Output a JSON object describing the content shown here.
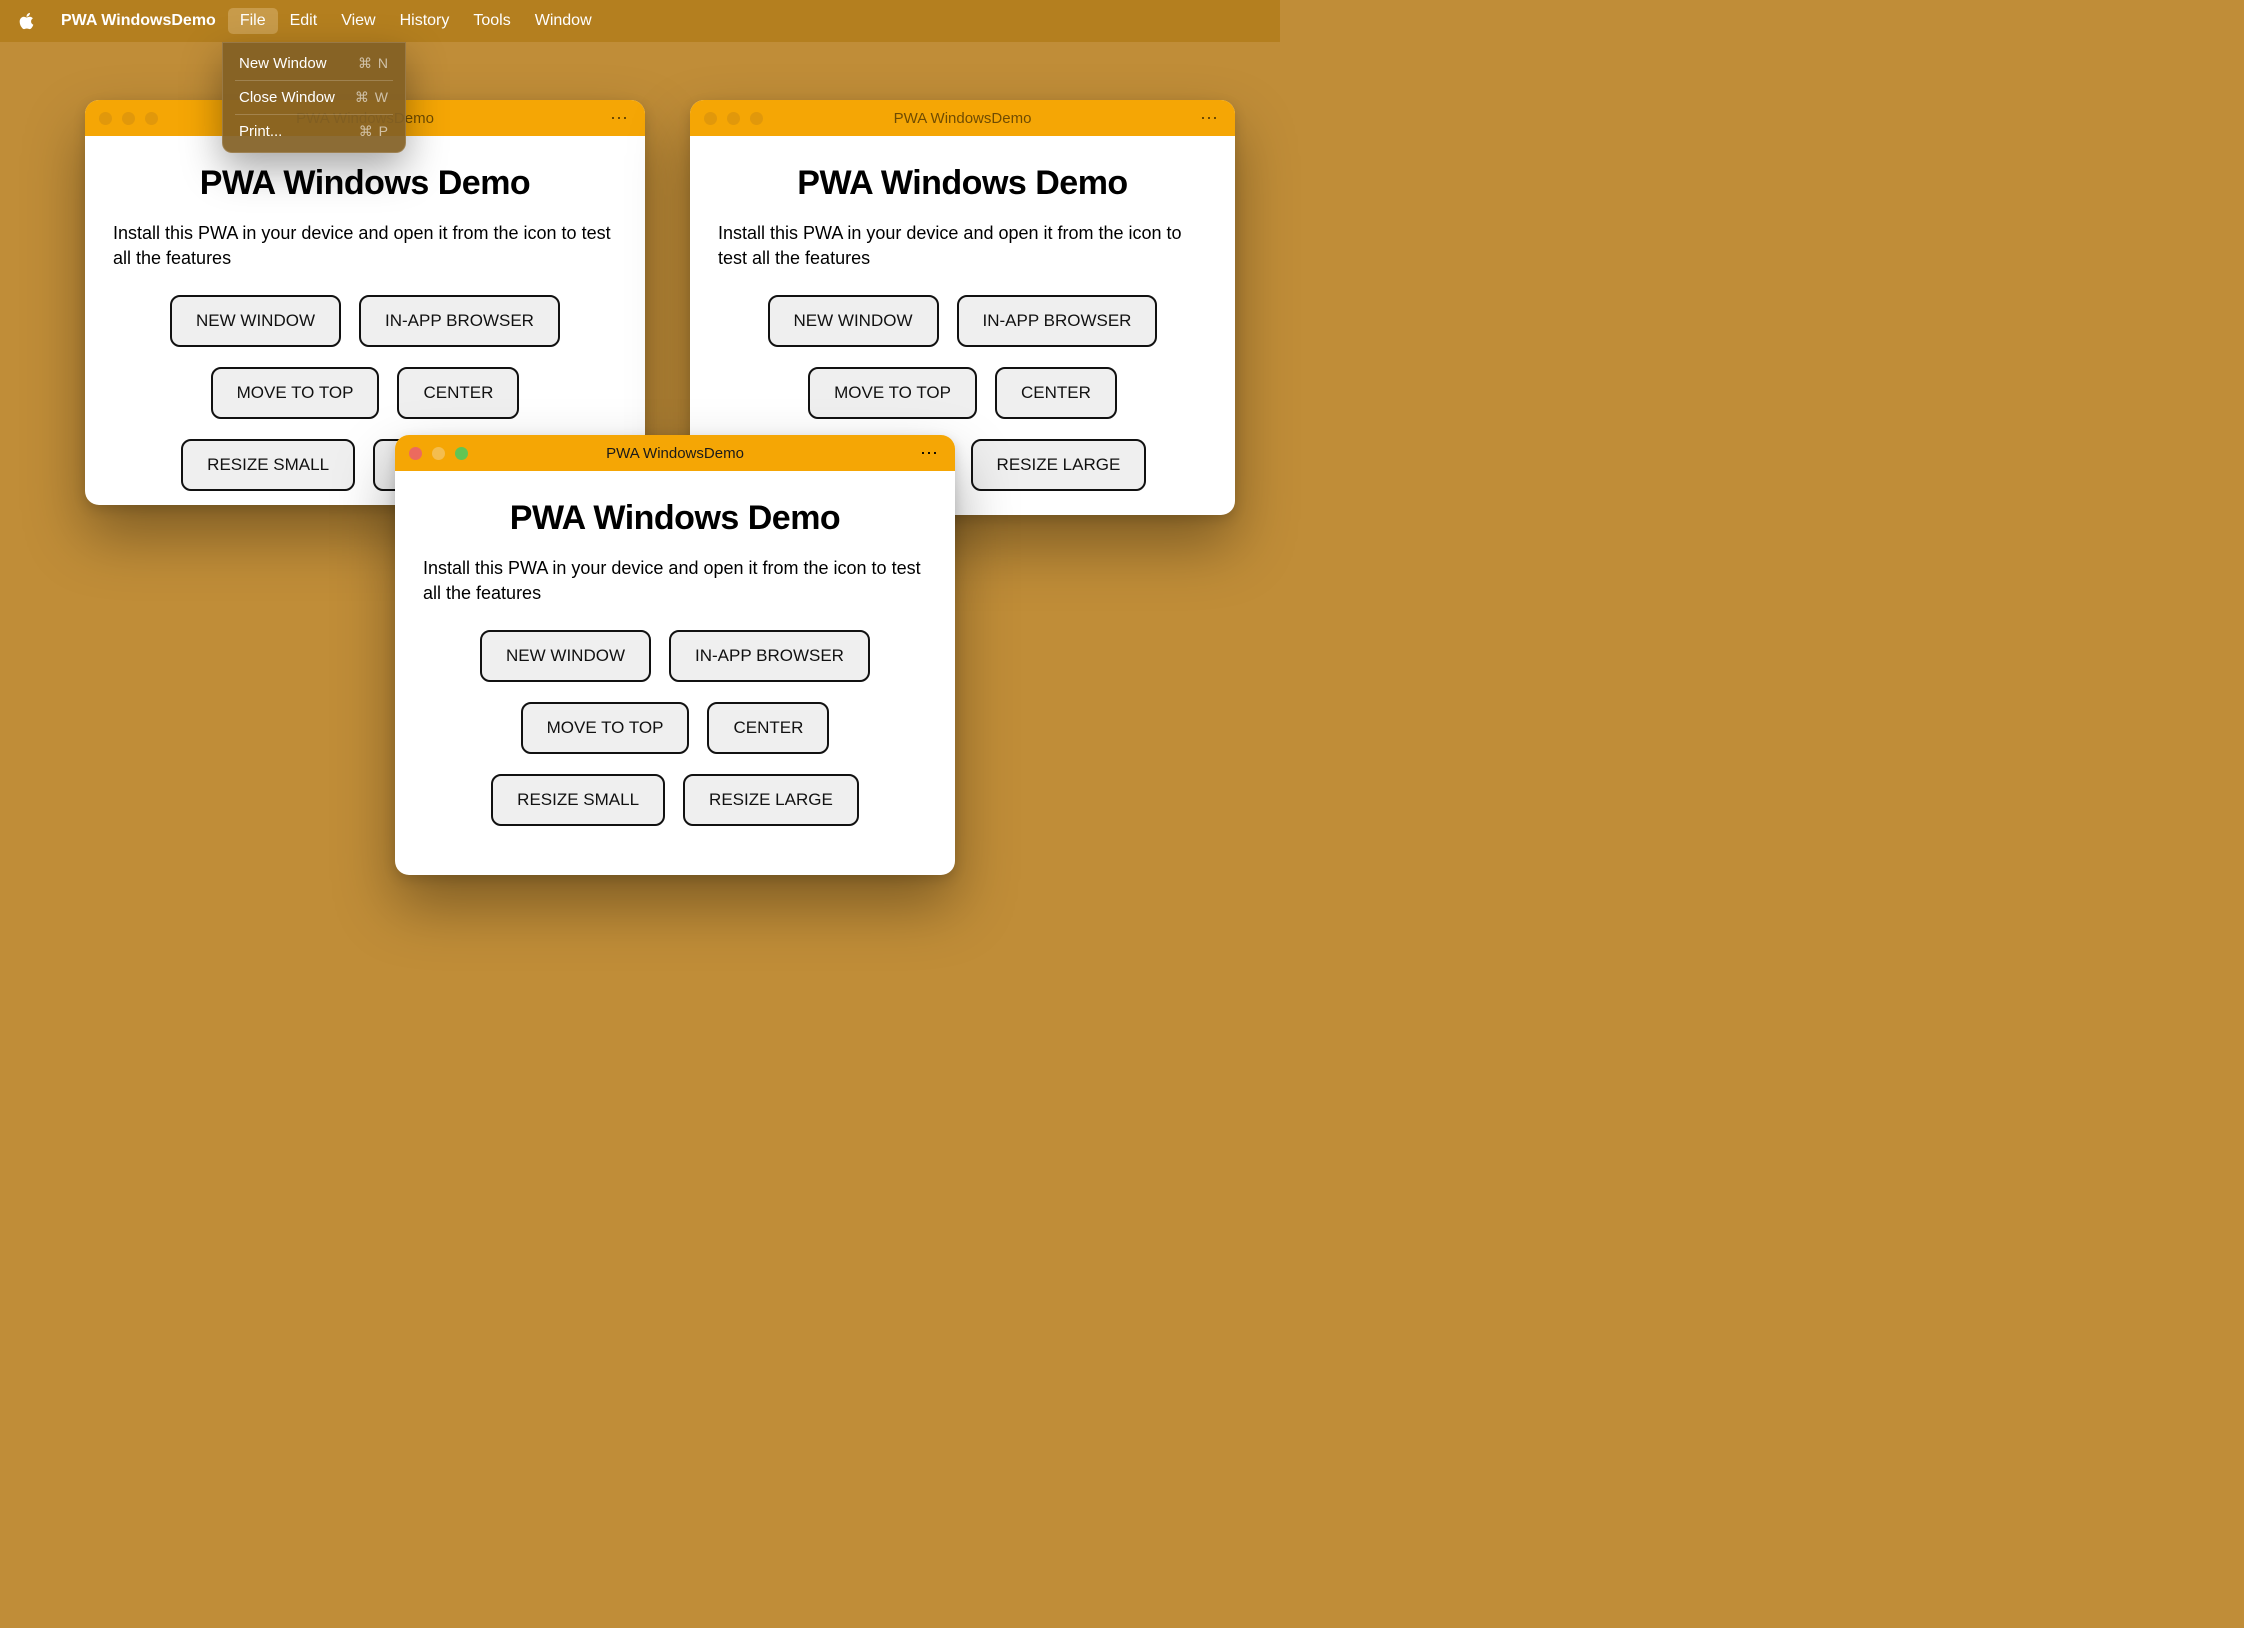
{
  "menubar": {
    "app_name": "PWA WindowsDemo",
    "items": [
      "File",
      "Edit",
      "View",
      "History",
      "Tools",
      "Window"
    ],
    "active_index": 0
  },
  "file_menu": {
    "items": [
      {
        "label": "New Window",
        "shortcut": "⌘ N"
      },
      {
        "label": "Close Window",
        "shortcut": "⌘ W"
      },
      {
        "label": "Print...",
        "shortcut": "⌘ P"
      }
    ]
  },
  "windows": [
    {
      "id": "win1",
      "title": "PWA WindowsDemo",
      "active": false
    },
    {
      "id": "win2",
      "title": "PWA WindowsDemo",
      "active": false
    },
    {
      "id": "win3",
      "title": "PWA WindowsDemo",
      "active": true
    }
  ],
  "app": {
    "heading": "PWA Windows Demo",
    "description": "Install this PWA in your device and open it from the icon to test all the features",
    "buttons": [
      [
        "NEW WINDOW",
        "IN-APP BROWSER"
      ],
      [
        "MOVE TO TOP",
        "CENTER"
      ],
      [
        "RESIZE SMALL",
        "RESIZE LARGE"
      ]
    ]
  }
}
